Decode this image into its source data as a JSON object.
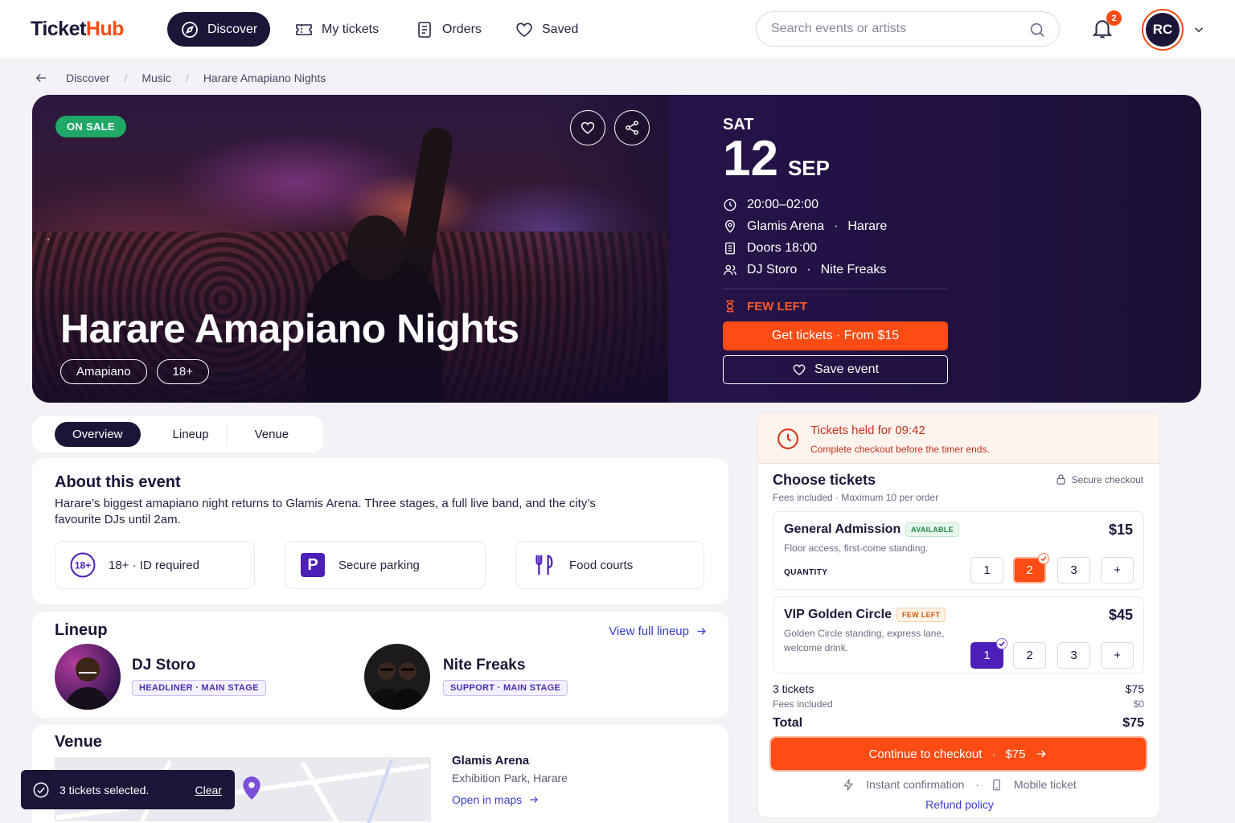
{
  "brand": {
    "name_a": "Ticket",
    "name_b": "Hub",
    "accent": "#ff4b14",
    "navy": "#1b1538"
  },
  "nav": {
    "items": [
      {
        "label": "Discover",
        "icon": "compass-icon"
      },
      {
        "label": "My tickets",
        "icon": "ticket-icon"
      },
      {
        "label": "Orders",
        "icon": "receipt-icon"
      },
      {
        "label": "Saved",
        "icon": "heart-icon"
      }
    ],
    "search_placeholder": "Search events or artists",
    "notifications": "2",
    "avatar_initials": "RC"
  },
  "breadcrumb": [
    "Discover",
    "Music",
    "Harare Amapiano Nights"
  ],
  "hero": {
    "status": "ON SALE",
    "title": "Harare Amapiano Nights",
    "tags": [
      "Amapiano",
      "18+"
    ],
    "day": "SAT",
    "date_num": "12",
    "month": "SEP",
    "time": "20:00–02:00",
    "venue": "Glamis Arena",
    "city": "Harare",
    "doors": "Doors 18:00",
    "artist_a": "DJ Storo",
    "artist_b": "Nite Freaks",
    "availability": "FEW LEFT",
    "get_tickets": "Get tickets · From $15",
    "save_event": "Save event"
  },
  "tabs": [
    "Overview",
    "Lineup",
    "Venue"
  ],
  "about": {
    "heading": "About this event",
    "description": "Harare’s biggest amapiano night returns to Glamis Arena. Three stages, a full live band, and the city’s favourite DJs until 2am.",
    "features": [
      {
        "label": "18+ · ID required",
        "icon": "age-18-icon"
      },
      {
        "label": "Secure parking",
        "icon": "parking-icon"
      },
      {
        "label": "Food courts",
        "icon": "cutlery-icon"
      }
    ]
  },
  "lineup": {
    "heading": "Lineup",
    "view_all": "View full lineup",
    "artists": [
      {
        "name": "DJ Storo",
        "role": "HEADLINER · MAIN STAGE"
      },
      {
        "name": "Nite Freaks",
        "role": "SUPPORT · MAIN STAGE"
      }
    ]
  },
  "venue": {
    "heading": "Venue",
    "name": "Glamis Arena",
    "address": "Exhibition Park, Harare",
    "link": "Open in maps"
  },
  "toast": {
    "text": "3 tickets selected.",
    "action": "Clear"
  },
  "checkout": {
    "held_title": "Tickets held for 09:42",
    "held_sub": "Complete checkout before the timer ends.",
    "heading": "Choose tickets",
    "secure": "Secure checkout",
    "fees_note": "Fees included · Maximum 10 per order",
    "quantity_label": "QUANTITY",
    "tiers": [
      {
        "name": "General Admission",
        "badge": "AVAILABLE",
        "price": "$15",
        "desc": "Floor access, first-come standing.",
        "selected": 2
      },
      {
        "name": "VIP Golden Circle",
        "badge": "FEW LEFT",
        "price": "$45",
        "desc_1": "Golden Circle standing, express lane,",
        "desc_2": "welcome drink.",
        "selected": 1
      }
    ],
    "qty_options": [
      "1",
      "2",
      "3",
      "+"
    ],
    "summary": [
      {
        "label": "3 tickets",
        "value": "$75"
      },
      {
        "label": "Fees included",
        "value": "$0"
      },
      {
        "label": "Total",
        "value": "$75"
      }
    ],
    "cta": "Continue to checkout",
    "cta_dot": "·",
    "cta_price": "$75",
    "instant": "Instant confirmation",
    "mobile": "Mobile ticket",
    "refund": "Refund policy"
  }
}
